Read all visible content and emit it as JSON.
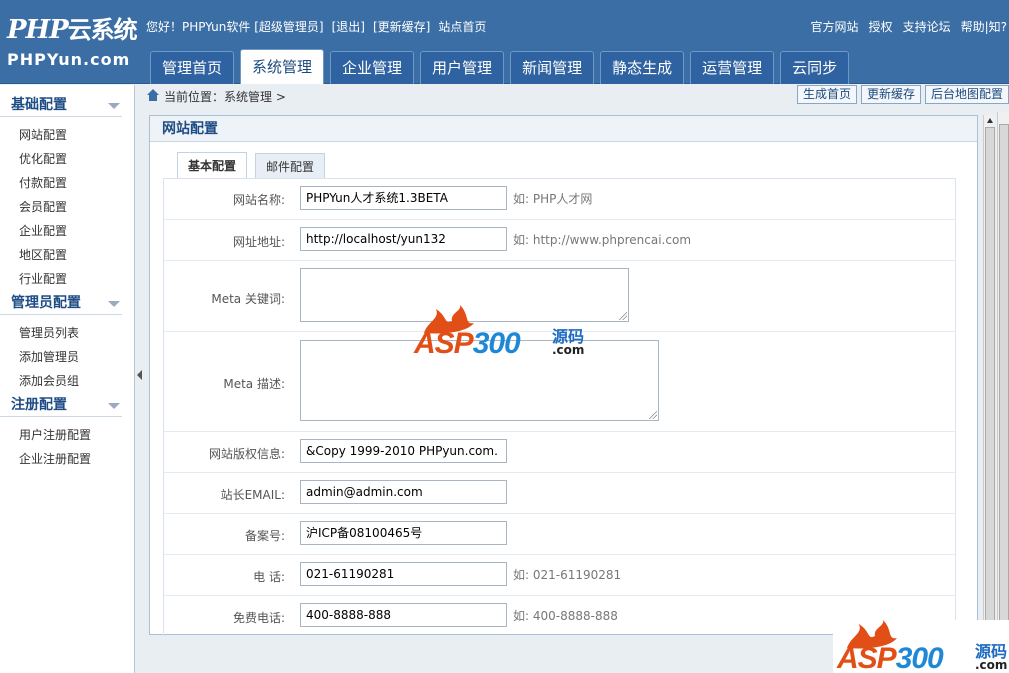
{
  "logo": {
    "line1": "PHP",
    "line1b": "云系统",
    "line2": "PHPYun.com"
  },
  "topbar": {
    "left": [
      "您好！PHPYun软件 [超级管理员]",
      "[退出]",
      "[更新缓存]",
      "站点首页"
    ],
    "right": [
      "官方网站",
      "授权",
      "支持论坛",
      "帮助|知?"
    ]
  },
  "nav": {
    "tabs": [
      "管理首页",
      "系统管理",
      "企业管理",
      "用户管理",
      "新闻管理",
      "静态生成",
      "运营管理",
      "云同步"
    ],
    "active": "系统管理"
  },
  "sidebar": {
    "sections": [
      {
        "title": "基础配置",
        "items": [
          "网站配置",
          "优化配置",
          "付款配置",
          "会员配置",
          "企业配置",
          "地区配置",
          "行业配置"
        ]
      },
      {
        "title": "管理员配置",
        "items": [
          "管理员列表",
          "添加管理员",
          "添加会员组"
        ]
      },
      {
        "title": "注册配置",
        "items": [
          "用户注册配置",
          "企业注册配置"
        ]
      }
    ]
  },
  "breadcrumb": {
    "text": "当前位置：系统管理 >",
    "buttons": [
      "生成首页",
      "更新缓存",
      "后台地图配置"
    ]
  },
  "panel": {
    "title": "网站配置",
    "subtabs": [
      "基本配置",
      "邮件配置"
    ]
  },
  "form": {
    "fields": [
      {
        "label": "网站名称:",
        "value": "PHPYun人才系统1.3BETA",
        "hint": "如: PHP人才网"
      },
      {
        "label": "网址地址:",
        "value": "http://localhost/yun132",
        "hint": "如: http://www.phprencai.com"
      },
      {
        "label": "Meta 关键词:",
        "value": "",
        "hint": ""
      },
      {
        "label": "Meta 描述:",
        "value": "",
        "hint": ""
      },
      {
        "label": "网站版权信息:",
        "value": "&Copy 1999-2010 PHPyun.com.",
        "hint": ""
      },
      {
        "label": "站长EMAIL:",
        "value": "admin@admin.com",
        "hint": ""
      },
      {
        "label": "备案号:",
        "value": "沪ICP备08100465号",
        "hint": ""
      },
      {
        "label": "电 话:",
        "value": "021-61190281",
        "hint": "如: 021-61190281"
      },
      {
        "label": "免费电话:",
        "value": "400-8888-888",
        "hint": "如: 400-8888-888"
      }
    ]
  },
  "watermark": {
    "text_a": "ASP",
    "text_b": "300",
    "cn": "源码",
    "com": ".com"
  },
  "colors": {
    "header": "#3a6ea5",
    "accent": "#1e4c84",
    "watermark_red": "#e24f16",
    "watermark_blue": "#1e88d6"
  }
}
